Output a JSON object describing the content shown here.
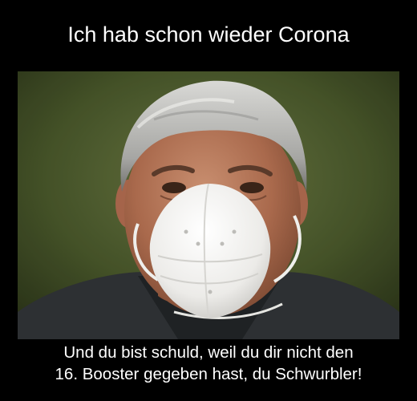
{
  "meme": {
    "top_text": "Ich hab schon wieder Corona",
    "bottom_text_line1": "Und du bist schuld, weil du dir nicht den",
    "bottom_text_line2": "16. Booster gegeben hast, du Schwurbler!"
  },
  "photo": {
    "subject": "man-wearing-white-ffp2-mask-icon"
  },
  "colors": {
    "background": "#000000",
    "text": "#ffffff",
    "photo_background": "#4a5a2e"
  }
}
